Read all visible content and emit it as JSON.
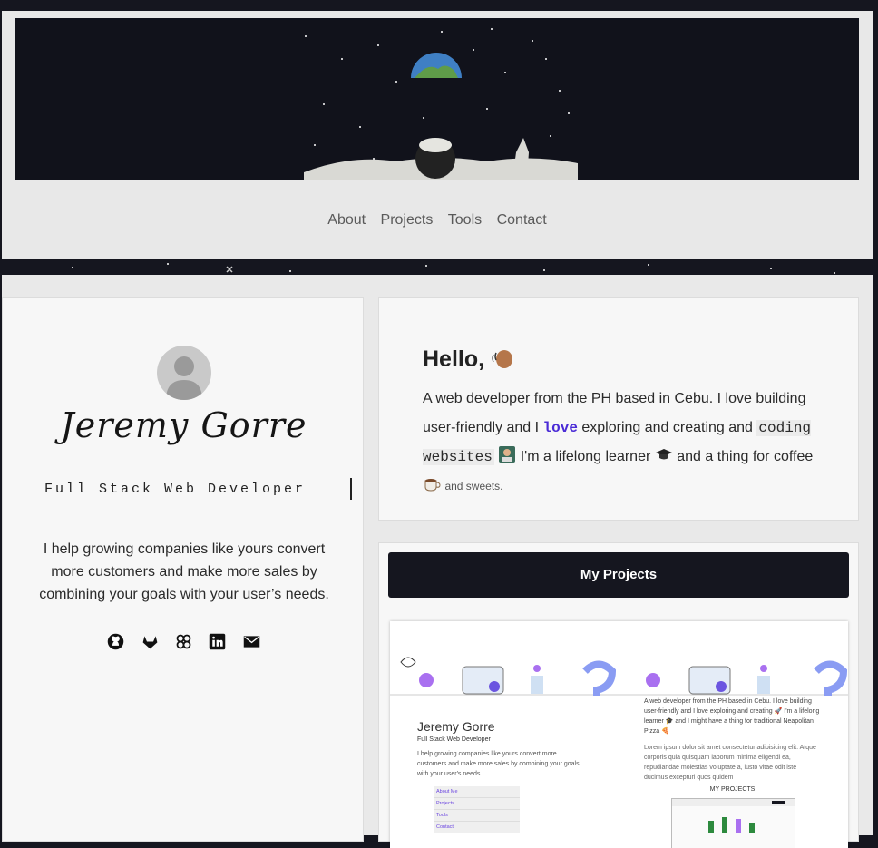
{
  "nav": {
    "items": [
      "About",
      "Projects",
      "Tools",
      "Contact"
    ]
  },
  "profile": {
    "name": "Jeremy Gorre",
    "role": "Full Stack Web Developer",
    "pitch": "I help growing companies like yours convert more customers and make more sales by combining your goals with your user’s needs.",
    "socials": [
      "github-icon",
      "gitlab-icon",
      "codepen-icon",
      "linkedin-icon",
      "mail-icon"
    ]
  },
  "hello": {
    "title": "Hello,",
    "part1": "A web developer from the PH based in Cebu. I love building user-friendly and I",
    "love": "love",
    "part2": "exploring and creating and",
    "code": "coding websites",
    "part3": "I'm a lifelong learner",
    "part4": "and a thing for coffee",
    "small": "and sweets."
  },
  "projects": {
    "button": "My Projects",
    "preview": {
      "name": "Jeremy Gorre",
      "role": "Full Stack Web Developer",
      "pitch": "I help growing companies like yours convert more customers and make more sales by combining your goals with your user's needs.",
      "nav": [
        "About Me",
        "Projects",
        "Tools",
        "Contact"
      ],
      "right1": "A web developer from the PH based in Cebu. I love building user-friendly and I love exploring and creating 🚀 I'm a lifelong learner 🎓 and I might have a thing for traditional Neapolitan Pizza 🍕",
      "right2": "Lorem ipsum dolor sit amet consectetur adipisicing elit. Atque corporis quia quisquam laborum minima eligendi ea, repudiandae molestias voluptate a, iusto vitae odit iste ducimus excepturi quos quidem",
      "my_projects": "MY PROJECTS"
    }
  },
  "colors": {
    "dark": "#15161f",
    "accent": "#4a2bd6",
    "panel": "#f7f7f7"
  }
}
